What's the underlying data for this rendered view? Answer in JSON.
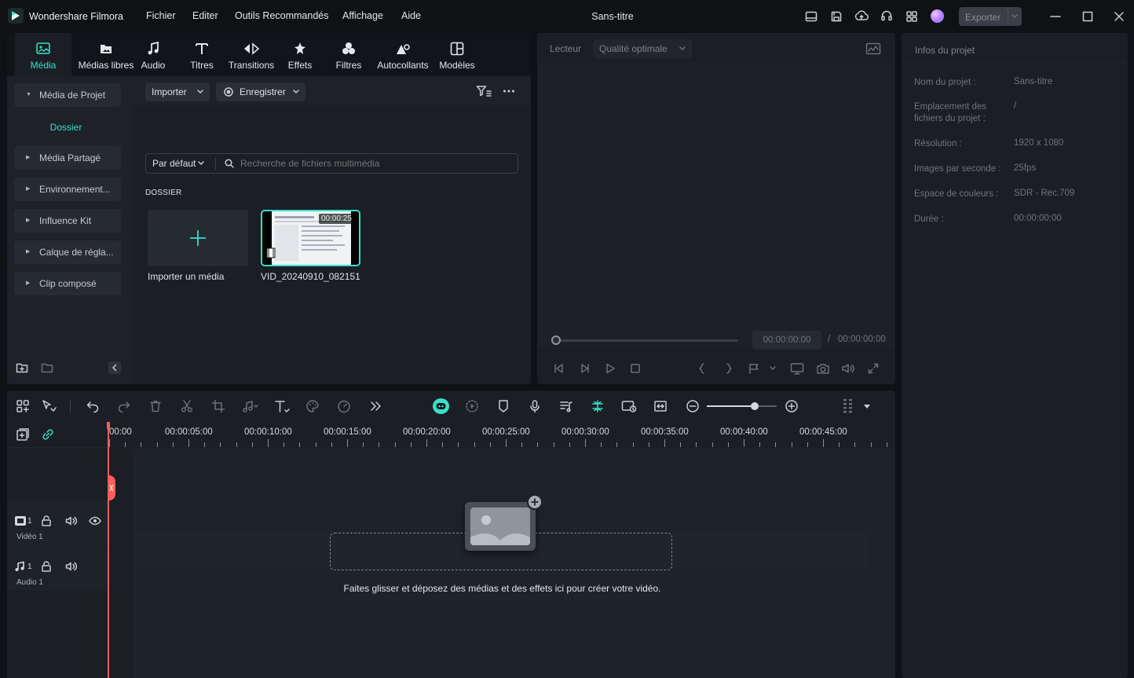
{
  "app": {
    "name": "Wondershare Filmora",
    "doc_title": "Sans-titre",
    "export_label": "Exporter"
  },
  "menu": [
    "Fichier",
    "Editer",
    "Outils Recommandés",
    "Affichage",
    "Aide"
  ],
  "media_tabs": [
    {
      "label": "Média",
      "icon": "media-icon",
      "active": true
    },
    {
      "label": "Médias libres",
      "icon": "stock-media-icon"
    },
    {
      "label": "Audio",
      "icon": "music-note-icon"
    },
    {
      "label": "Titres",
      "icon": "titles-icon"
    },
    {
      "label": "Transitions",
      "icon": "transitions-icon"
    },
    {
      "label": "Effets",
      "icon": "effects-icon"
    },
    {
      "label": "Filtres",
      "icon": "filters-icon"
    },
    {
      "label": "Autocollants",
      "icon": "stickers-icon"
    },
    {
      "label": "Modèles",
      "icon": "templates-icon"
    }
  ],
  "sidebar": {
    "items": [
      "Média de Projet",
      "Média Partagé",
      "Environnement...",
      "Influence Kit",
      "Calque de régla...",
      "Clip composé"
    ],
    "sub_folder": "Dossier"
  },
  "media": {
    "import_label": "Importer",
    "record_label": "Enregistrer",
    "sort_label": "Par défaut",
    "search_placeholder": "Recherche de fichiers multimédia",
    "section_label": "DOSSIER",
    "import_tile_label": "Importer un média",
    "clip": {
      "name": "VID_20240910_082151",
      "duration": "00:00:25"
    }
  },
  "player": {
    "label": "Lecteur",
    "quality": "Qualité optimale",
    "current_time": "00:00:00:00",
    "separator": "/",
    "total_time": "00:00:00:00"
  },
  "project_info": {
    "title": "Infos du projet",
    "rows": [
      {
        "key": "Nom du projet :",
        "value": "Sans-titre"
      },
      {
        "key": "Emplacement des fichiers du projet :",
        "value": "/"
      },
      {
        "key": "Résolution :",
        "value": "1920 x 1080"
      },
      {
        "key": "Images par seconde :",
        "value": "25fps"
      },
      {
        "key": "Espace de couleurs :",
        "value": "SDR - Rec.709"
      },
      {
        "key": "Durée :",
        "value": "00:00:00:00"
      }
    ]
  },
  "timeline": {
    "ruler": [
      "00:00",
      "00:00:05:00",
      "00:00:10:00",
      "00:00:15:00",
      "00:00:20:00",
      "00:00:25:00",
      "00:00:30:00",
      "00:00:35:00",
      "00:00:40:00",
      "00:00:45:00"
    ],
    "tracks": [
      {
        "num": "1",
        "name": "Vidéo 1"
      },
      {
        "num": "1",
        "name": "Audio 1"
      }
    ],
    "drop_hint": "Faites glisser et déposez des médias et des effets ici pour créer votre vidéo.",
    "zoom_level": 0.68
  },
  "colors": {
    "accent": "#36e0c8",
    "playhead": "#ff5b5b",
    "bg": "#1b1e24"
  }
}
